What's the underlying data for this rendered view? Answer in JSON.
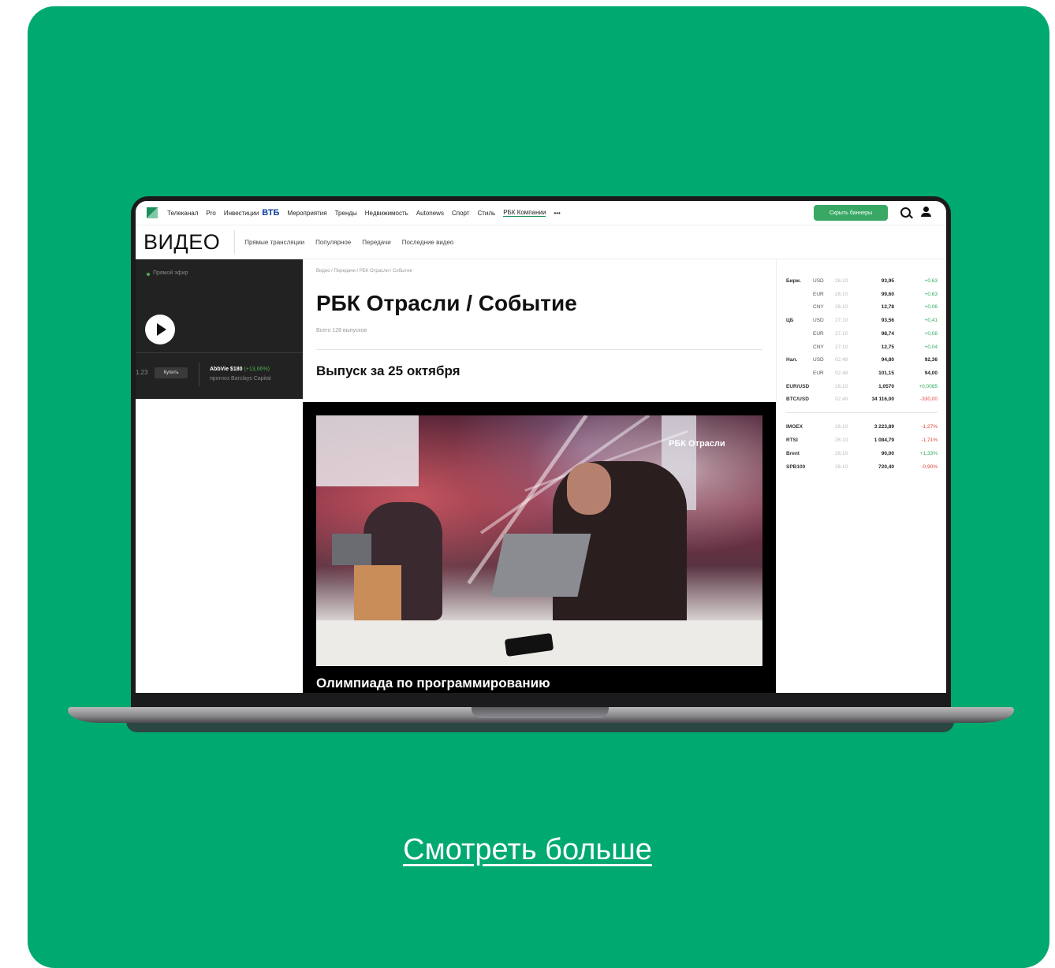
{
  "topnav": {
    "links": [
      "Телеканал",
      "Pro",
      "Инвестиции",
      "ВТБ",
      "Мероприятия",
      "Тренды",
      "Недвижимость",
      "Autonews",
      "Спорт",
      "Стиль",
      "РБК Компании",
      "•••"
    ],
    "close_banners": "Скрыть баннеры"
  },
  "subnav": {
    "title": "ВИДЕО",
    "links": [
      "Прямые трансляции",
      "Популярное",
      "Передачи",
      "Последние видео"
    ]
  },
  "left": {
    "live_label": "Прямой эфир",
    "buy_label": "Купить",
    "ticker_fragment": "1.23",
    "promo_title": "AbbVie $180",
    "promo_change": "(+13,66%)",
    "promo_sub": "прогноз Barclays Capital"
  },
  "main": {
    "breadcrumb": "Видео / Передачи / РБК Отрасли / Событие",
    "title": "РБК Отрасли / Событие",
    "episodes": "Всего 128 выпусков",
    "issue_title": "Выпуск за 25 октября",
    "video_watermark": "РБК Отрасли",
    "video_caption": "Олимпиада по программированию"
  },
  "quotes": [
    {
      "group": "Бирж.",
      "cur": "USD",
      "date": "26.10",
      "value": "93,95",
      "change": "+0,63",
      "dir": "pos"
    },
    {
      "group": "",
      "cur": "EUR",
      "date": "26.10",
      "value": "99,60",
      "change": "+0,63",
      "dir": "pos"
    },
    {
      "group": "",
      "cur": "CNY",
      "date": "26.10",
      "value": "12,78",
      "change": "+0,06",
      "dir": "pos"
    },
    {
      "group": "ЦБ",
      "cur": "USD",
      "date": "27.10",
      "value": "93,56",
      "change": "+0,41",
      "dir": "pos"
    },
    {
      "group": "",
      "cur": "EUR",
      "date": "27.10",
      "value": "98,74",
      "change": "+0,08",
      "dir": "pos"
    },
    {
      "group": "",
      "cur": "CNY",
      "date": "27.10",
      "value": "12,75",
      "change": "+0,04",
      "dir": "pos"
    },
    {
      "group": "Нал.",
      "cur": "USD",
      "date": "02.48",
      "value": "94,80",
      "change": "92,36",
      "dir": "dark"
    },
    {
      "group": "",
      "cur": "EUR",
      "date": "02.48",
      "value": "101,15",
      "change": "94,00",
      "dir": "dark"
    },
    {
      "group": "EUR/USD",
      "cur": "",
      "date": "26.10",
      "value": "1,0570",
      "change": "+0,0085",
      "dir": "pos"
    },
    {
      "group": "BTC/USD",
      "cur": "",
      "date": "02.48",
      "value": "34 116,00",
      "change": "-330,00",
      "dir": "neg"
    }
  ],
  "indices": [
    {
      "name": "IMOEX",
      "date": "26.10",
      "value": "3 223,89",
      "change": "-1,27%",
      "dir": "neg"
    },
    {
      "name": "RTSI",
      "date": "26.10",
      "value": "1 084,79",
      "change": "-1,71%",
      "dir": "neg"
    },
    {
      "name": "Brent",
      "date": "26.10",
      "value": "90,00",
      "change": "+1,33%",
      "dir": "pos"
    },
    {
      "name": "SPB100",
      "date": "26.10",
      "value": "720,40",
      "change": "-0,90%",
      "dir": "neg"
    }
  ],
  "cta": {
    "label": "Смотреть больше"
  },
  "colors": {
    "card_bg": "#00a96f",
    "accent_green": "#39a865",
    "positive": "#2eaa5c",
    "negative": "#e2463a"
  }
}
